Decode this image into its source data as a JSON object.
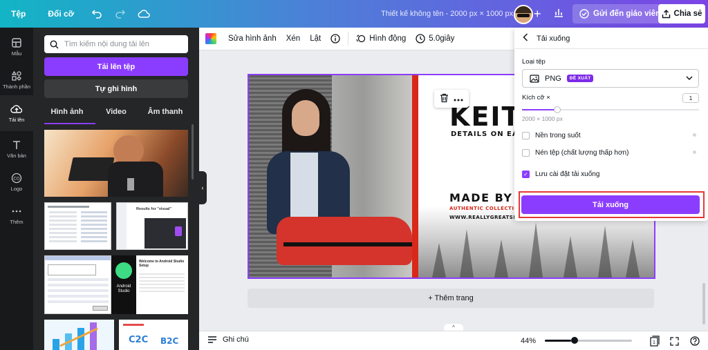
{
  "topbar": {
    "file_menu": "Tệp",
    "resize_menu": "Đổi cỡ",
    "doc_title": "Thiết kế không tên - 2000 px × 1000 px",
    "send_teacher": "Gửi đến giáo viên",
    "share": "Chia sẻ"
  },
  "rail": {
    "items": [
      {
        "label": "Mẫu",
        "icon": "template-icon"
      },
      {
        "label": "Thành phần",
        "icon": "elements-icon"
      },
      {
        "label": "Tải lên",
        "icon": "upload-cloud-icon"
      },
      {
        "label": "Văn bản",
        "icon": "text-icon"
      },
      {
        "label": "Logo",
        "icon": "logo-icon"
      },
      {
        "label": "Thêm",
        "icon": "more-icon"
      }
    ]
  },
  "panel": {
    "search_placeholder": "Tìm kiếm nội dung tải lên",
    "upload_button": "Tải lên tệp",
    "record_button": "Tự ghi hình",
    "tabs": [
      "Hình ảnh",
      "Video",
      "Âm thanh"
    ],
    "thumb_texts": {
      "results_title": "Results for \"visual\"",
      "android_title": "Welcome to Android Studio Setup",
      "android_logo": "Android Studio"
    }
  },
  "canvas_toolbar": {
    "edit_image": "Sửa hình ảnh",
    "crop": "Xén",
    "flip": "Lật",
    "animate": "Hình động",
    "duration": "5.0giây"
  },
  "design": {
    "brand": "KEIT",
    "details": "DETAILS ON EACH",
    "made_by": "MADE BY LO",
    "authentic": "AUTHENTIC COLLECTION T-",
    "website": "WWW.REALLYGREATSITE.CO"
  },
  "add_page": "+ Thêm trang",
  "bottombar": {
    "notes": "Ghi chú",
    "zoom": "44%",
    "zoom_value_percent": 44,
    "page_count": "1"
  },
  "download": {
    "title": "Tải xuống",
    "file_type_label": "Loại tệp",
    "file_type_value": "PNG",
    "recommended_badge": "ĐỀ XUẤT",
    "size_label": "Kích cỡ ×",
    "size_value": "1",
    "size_slider_percent": 20,
    "dimensions": "2000 × 1000 px",
    "options": [
      {
        "label": "Nền trong suốt",
        "checked": false
      },
      {
        "label": "Nén tệp (chất lượng thấp hơn)",
        "checked": false
      },
      {
        "label": "Lưu cài đặt tải xuống",
        "checked": true
      }
    ],
    "download_button": "Tải xuống"
  },
  "colors": {
    "accent": "#8b3dff",
    "highlight": "#e53935",
    "design_red": "#d8281a"
  }
}
